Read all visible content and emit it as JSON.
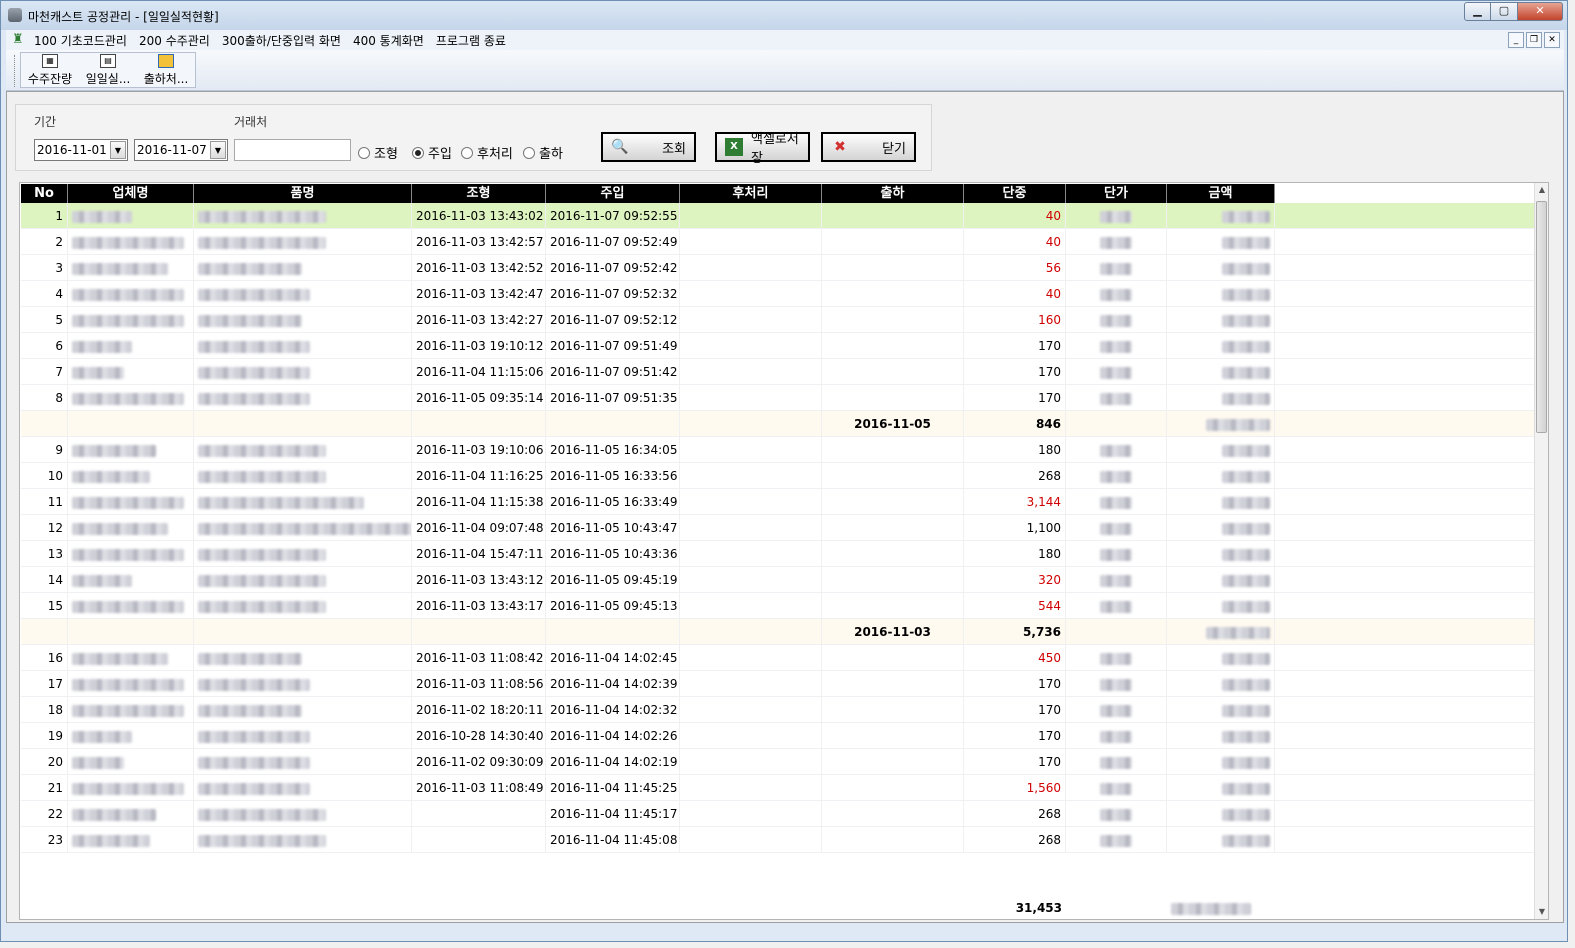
{
  "window": {
    "title": "마천캐스트 공정관리 - [일일실적현황]",
    "buttons": {
      "minimize": "▁",
      "maximize": "▢",
      "close": "✕"
    }
  },
  "menu": [
    "100 기초코드관리",
    "200 수주관리",
    "300출하/단중입력 화면",
    "400 통계화면",
    "프로그램 종료"
  ],
  "mdi": {
    "minimize": "_",
    "restore": "❐",
    "close": "✕"
  },
  "toolbar": [
    {
      "label": "수주잔량",
      "icon": "grid-report-icon"
    },
    {
      "label": "일일실...",
      "icon": "document-chart-icon"
    },
    {
      "label": "출하처...",
      "icon": "box-ship-icon"
    }
  ],
  "filter": {
    "period_label": "기간",
    "partner_label": "거래처",
    "date_from": "2016-11-01",
    "date_to": "2016-11-07",
    "partner_value": "",
    "radios": [
      {
        "label": "조형",
        "checked": false
      },
      {
        "label": "주입",
        "checked": true
      },
      {
        "label": "후처리",
        "checked": false
      },
      {
        "label": "출하",
        "checked": false
      }
    ],
    "search_label": "조회",
    "excel_label": "액셀로저장",
    "close_label": "닫기"
  },
  "grid": {
    "columns": [
      "No",
      "업체명",
      "품명",
      "조형",
      "주입",
      "후처리",
      "출하",
      "단중",
      "단가",
      "금액"
    ],
    "rows": [
      {
        "type": "data",
        "no": "1",
        "molding": "2016-11-03 13:43:02",
        "pouring": "2016-11-07 09:52:55",
        "weight": "40",
        "red": true,
        "selected": true
      },
      {
        "type": "data",
        "no": "2",
        "molding": "2016-11-03 13:42:57",
        "pouring": "2016-11-07 09:52:49",
        "weight": "40",
        "red": true
      },
      {
        "type": "data",
        "no": "3",
        "molding": "2016-11-03 13:42:52",
        "pouring": "2016-11-07 09:52:42",
        "weight": "56",
        "red": true
      },
      {
        "type": "data",
        "no": "4",
        "molding": "2016-11-03 13:42:47",
        "pouring": "2016-11-07 09:52:32",
        "weight": "40",
        "red": true
      },
      {
        "type": "data",
        "no": "5",
        "molding": "2016-11-03 13:42:27",
        "pouring": "2016-11-07 09:52:12",
        "weight": "160",
        "red": true
      },
      {
        "type": "data",
        "no": "6",
        "molding": "2016-11-03 19:10:12",
        "pouring": "2016-11-07 09:51:49",
        "weight": "170",
        "red": false
      },
      {
        "type": "data",
        "no": "7",
        "molding": "2016-11-04 11:15:06",
        "pouring": "2016-11-07 09:51:42",
        "weight": "170",
        "red": false
      },
      {
        "type": "data",
        "no": "8",
        "molding": "2016-11-05 09:35:14",
        "pouring": "2016-11-07 09:51:35",
        "weight": "170",
        "red": false
      },
      {
        "type": "sub",
        "date": "2016-11-05",
        "weight": "846"
      },
      {
        "type": "data",
        "no": "9",
        "molding": "2016-11-03 19:10:06",
        "pouring": "2016-11-05 16:34:05",
        "weight": "180",
        "red": false
      },
      {
        "type": "data",
        "no": "10",
        "molding": "2016-11-04 11:16:25",
        "pouring": "2016-11-05 16:33:56",
        "weight": "268",
        "red": false
      },
      {
        "type": "data",
        "no": "11",
        "molding": "2016-11-04 11:15:38",
        "pouring": "2016-11-05 16:33:49",
        "weight": "3,144",
        "red": true
      },
      {
        "type": "data",
        "no": "12",
        "molding": "2016-11-04 09:07:48",
        "pouring": "2016-11-05 10:43:47",
        "weight": "1,100",
        "red": false
      },
      {
        "type": "data",
        "no": "13",
        "molding": "2016-11-04 15:47:11",
        "pouring": "2016-11-05 10:43:36",
        "weight": "180",
        "red": false
      },
      {
        "type": "data",
        "no": "14",
        "molding": "2016-11-03 13:43:12",
        "pouring": "2016-11-05 09:45:19",
        "weight": "320",
        "red": true
      },
      {
        "type": "data",
        "no": "15",
        "molding": "2016-11-03 13:43:17",
        "pouring": "2016-11-05 09:45:13",
        "weight": "544",
        "red": true
      },
      {
        "type": "sub",
        "date": "2016-11-03",
        "weight": "5,736"
      },
      {
        "type": "data",
        "no": "16",
        "molding": "2016-11-03 11:08:42",
        "pouring": "2016-11-04 14:02:45",
        "weight": "450",
        "red": true
      },
      {
        "type": "data",
        "no": "17",
        "molding": "2016-11-03 11:08:56",
        "pouring": "2016-11-04 14:02:39",
        "weight": "170",
        "red": false
      },
      {
        "type": "data",
        "no": "18",
        "molding": "2016-11-02 18:20:11",
        "pouring": "2016-11-04 14:02:32",
        "weight": "170",
        "red": false
      },
      {
        "type": "data",
        "no": "19",
        "molding": "2016-10-28 14:30:40",
        "pouring": "2016-11-04 14:02:26",
        "weight": "170",
        "red": false
      },
      {
        "type": "data",
        "no": "20",
        "molding": "2016-11-02 09:30:09",
        "pouring": "2016-11-04 14:02:19",
        "weight": "170",
        "red": false
      },
      {
        "type": "data",
        "no": "21",
        "molding": "2016-11-03 11:08:49",
        "pouring": "2016-11-04 11:45:25",
        "weight": "1,560",
        "red": true
      },
      {
        "type": "data",
        "no": "22",
        "molding": "",
        "pouring": "2016-11-04 11:45:17",
        "weight": "268",
        "red": false
      },
      {
        "type": "data",
        "no": "23",
        "molding": "",
        "pouring": "2016-11-04 11:45:08",
        "weight": "268",
        "red": false
      }
    ],
    "total_weight": "31,453"
  },
  "colors": {
    "selected_row": "#def4c0",
    "subtotal_row": "#fffaf0",
    "red_value": "#d00000",
    "header_bg": "#000000"
  }
}
